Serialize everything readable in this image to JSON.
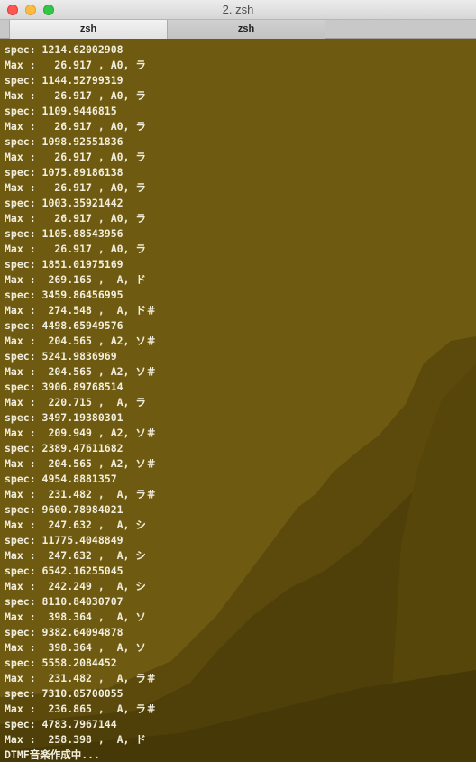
{
  "window": {
    "title": "2. zsh"
  },
  "tabs": [
    {
      "label": "zsh"
    },
    {
      "label": "zsh"
    }
  ],
  "terminal": {
    "lines": [
      "spec: 1214.62002908",
      "Max :   26.917 , A0, ラ",
      "spec: 1144.52799319",
      "Max :   26.917 , A0, ラ",
      "spec: 1109.9446815",
      "Max :   26.917 , A0, ラ",
      "spec: 1098.92551836",
      "Max :   26.917 , A0, ラ",
      "spec: 1075.89186138",
      "Max :   26.917 , A0, ラ",
      "spec: 1003.35921442",
      "Max :   26.917 , A0, ラ",
      "spec: 1105.88543956",
      "Max :   26.917 , A0, ラ",
      "spec: 1851.01975169",
      "Max :  269.165 ,  A, ド",
      "spec: 3459.86456995",
      "Max :  274.548 ,  A, ド＃",
      "spec: 4498.65949576",
      "Max :  204.565 , A2, ソ＃",
      "spec: 5241.9836969",
      "Max :  204.565 , A2, ソ＃",
      "spec: 3906.89768514",
      "Max :  220.715 ,  A, ラ",
      "spec: 3497.19380301",
      "Max :  209.949 , A2, ソ＃",
      "spec: 2389.47611682",
      "Max :  204.565 , A2, ソ＃",
      "spec: 4954.8881357",
      "Max :  231.482 ,  A, ラ＃",
      "spec: 9600.78984021",
      "Max :  247.632 ,  A, シ",
      "spec: 11775.4048849",
      "Max :  247.632 ,  A, シ",
      "spec: 6542.16255045",
      "Max :  242.249 ,  A, シ",
      "spec: 8110.84030707",
      "Max :  398.364 ,  A, ソ",
      "spec: 9382.64094878",
      "Max :  398.364 ,  A, ソ",
      "spec: 5558.2084452",
      "Max :  231.482 ,  A, ラ＃",
      "spec: 7310.05700055",
      "Max :  236.865 ,  A, ラ＃",
      "spec: 4783.7967144",
      "Max :  258.398 ,  A, ド",
      "DTMF音楽作成中..."
    ]
  },
  "colors": {
    "background": "#6e5a10",
    "text": "#f2eedd",
    "close": "#fc5753",
    "minimize": "#fdbc40",
    "zoom": "#33c748"
  }
}
